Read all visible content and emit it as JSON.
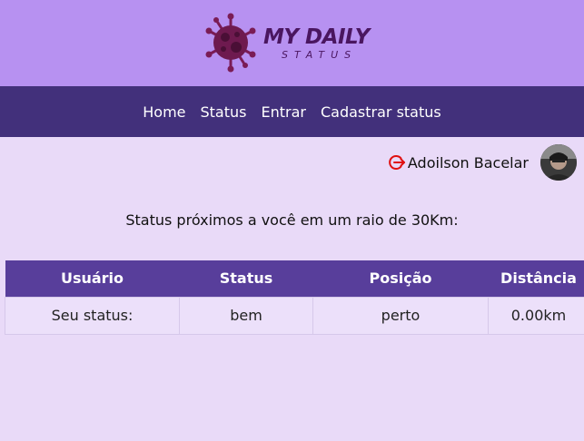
{
  "brand": {
    "title": "MY DAILY",
    "subtitle": "STATUS",
    "primary_color": "#4a1660",
    "header_bg": "#b791f1",
    "nav_bg": "#42307b",
    "table_header_bg": "#583e9b",
    "page_bg": "#e9daf8"
  },
  "nav": {
    "items": [
      "Home",
      "Status",
      "Entrar",
      "Cadastrar status"
    ]
  },
  "user": {
    "name": "Adoilson Bacelar",
    "logout_icon": "logout-icon",
    "avatar_icon": "avatar"
  },
  "main": {
    "subtitle": "Status próximos a você em um raio de 30Km:"
  },
  "table": {
    "headers": [
      "Usuário",
      "Status",
      "Posição",
      "Distância"
    ],
    "rows": [
      [
        "Seu status:",
        "bem",
        "perto",
        "0.00km"
      ]
    ]
  }
}
